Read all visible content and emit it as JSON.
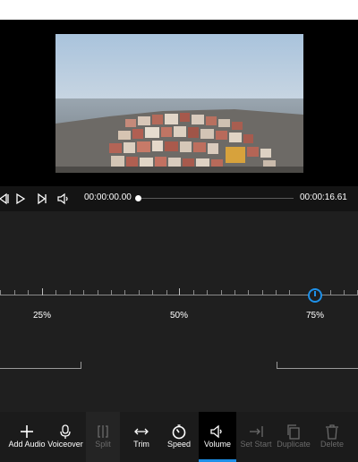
{
  "player": {
    "current_time": "00:00:00.00",
    "total_time": "00:00:16.61",
    "playback_progress": 0.0
  },
  "volume": {
    "value_percent": 75,
    "scale_labels": [
      "25%",
      "50%",
      "75%"
    ]
  },
  "toolbar": {
    "items": [
      {
        "label": "Add Audio",
        "icon": "plus-icon",
        "enabled": true
      },
      {
        "label": "Voiceover",
        "icon": "microphone-icon",
        "enabled": true
      },
      {
        "label": "Split",
        "icon": "split-icon",
        "enabled": false
      },
      {
        "label": "Trim",
        "icon": "trim-arrows-icon",
        "enabled": true
      },
      {
        "label": "Speed",
        "icon": "speed-dial-icon",
        "enabled": true
      },
      {
        "label": "Volume",
        "icon": "speaker-icon",
        "enabled": true,
        "selected": true
      },
      {
        "label": "Set Start",
        "icon": "set-start-icon",
        "enabled": false
      },
      {
        "label": "Duplicate",
        "icon": "duplicate-icon",
        "enabled": false
      },
      {
        "label": "Delete",
        "icon": "trash-icon",
        "enabled": false
      }
    ]
  },
  "colors": {
    "accent": "#1e90e8",
    "background": "#1f1f1f",
    "toolbar_bg": "#1b1b1b"
  }
}
